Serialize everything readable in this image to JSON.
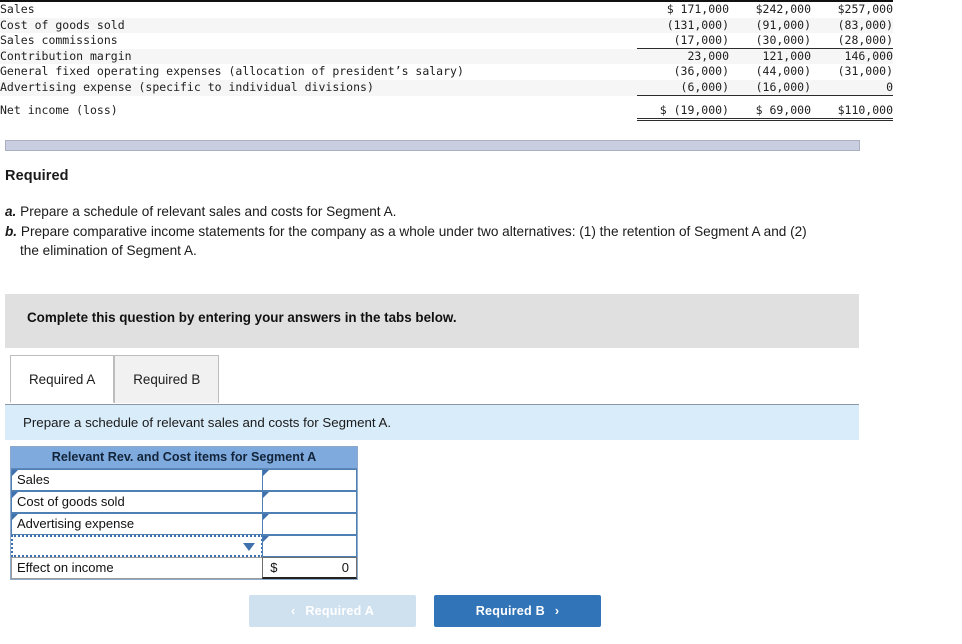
{
  "financial_table": {
    "rows": [
      {
        "label": "Sales",
        "values": [
          "$ 171,000",
          "$242,000",
          "$257,000"
        ],
        "shaded": false,
        "rule": "none"
      },
      {
        "label": "Cost of goods sold",
        "values": [
          "(131,000)",
          "(91,000)",
          "(83,000)"
        ],
        "shaded": true,
        "rule": "none"
      },
      {
        "label": "Sales commissions",
        "values": [
          "(17,000)",
          "(30,000)",
          "(28,000)"
        ],
        "shaded": false,
        "rule": "under"
      },
      {
        "label": "Contribution margin",
        "values": [
          "23,000",
          "121,000",
          "146,000"
        ],
        "shaded": true,
        "rule": "none"
      },
      {
        "label": "General fixed operating expenses (allocation of president’s salary)",
        "values": [
          "(36,000)",
          "(44,000)",
          "(31,000)"
        ],
        "shaded": false,
        "rule": "none"
      },
      {
        "label": "Advertising expense (specific to individual divisions)",
        "values": [
          "(6,000)",
          "(16,000)",
          "0"
        ],
        "shaded": true,
        "rule": "under"
      },
      {
        "label": "Net income (loss)",
        "values": [
          "$ (19,000)",
          "$ 69,000",
          "$110,000"
        ],
        "shaded": false,
        "rule": "double"
      }
    ]
  },
  "required": {
    "heading": "Required",
    "items": [
      {
        "marker": "a.",
        "text": "Prepare a schedule of relevant sales and costs for Segment A.",
        "continuation": ""
      },
      {
        "marker": "b.",
        "text": "Prepare comparative income statements for the company as a whole under two alternatives: (1) the retention of Segment A and (2)",
        "continuation": "the elimination of Segment A."
      }
    ]
  },
  "complete_box": {
    "text": "Complete this question by entering your answers in the tabs below."
  },
  "tabs": [
    {
      "label": "Required A",
      "active": true
    },
    {
      "label": "Required B",
      "active": false
    }
  ],
  "instruction_bar": {
    "text": "Prepare a schedule of relevant sales and costs for Segment A."
  },
  "answer_grid": {
    "header": "Relevant Rev. and Cost items for Segment A",
    "rows": [
      {
        "label": "Sales",
        "value": "",
        "type": "input"
      },
      {
        "label": "Cost of goods sold",
        "value": "",
        "type": "input"
      },
      {
        "label": "Advertising expense",
        "value": "",
        "type": "input"
      },
      {
        "label": "",
        "value": "",
        "type": "dropdown"
      }
    ],
    "total": {
      "label": "Effect on income",
      "currency": "$",
      "value": "0"
    }
  },
  "nav": {
    "prev_label": "Required A",
    "prev_chevron": "‹",
    "next_label": "Required B",
    "next_chevron": "›"
  },
  "colors": {
    "grid_header_blue": "#7eaadd",
    "grid_border_blue": "#4e7fb5",
    "instruction_blue": "#d9ecf9",
    "complete_gray": "#e0e0e0",
    "next_button_blue": "#3174b8",
    "prev_button_blue": "#cfe0ef",
    "scrollbar": "#c9cfe0"
  }
}
